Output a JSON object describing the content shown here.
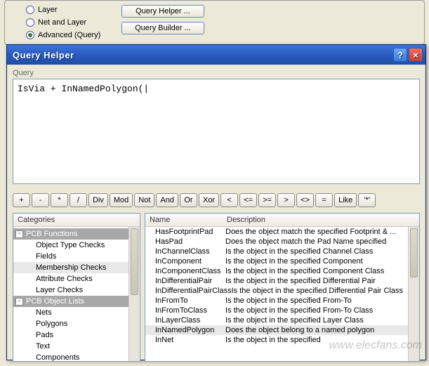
{
  "top_radio": {
    "layer": "Layer",
    "net_and_layer": "Net and Layer",
    "advanced": "Advanced (Query)",
    "selected": "advanced"
  },
  "top_buttons": {
    "query_helper": "Query Helper ...",
    "query_builder": "Query Builder ..."
  },
  "dialog": {
    "title": "Query Helper",
    "help": "?",
    "close": "×",
    "query_label": "Query",
    "query_text": "IsVia + InNamedPolygon(|"
  },
  "ops": [
    "+",
    "-",
    "*",
    "/",
    "Div",
    "Mod",
    "Not",
    "And",
    "Or",
    "Xor",
    "<",
    "<=",
    ">=",
    ">",
    "<>",
    "=",
    "Like",
    "'*'"
  ],
  "categories": {
    "header": "Categories",
    "groups": [
      {
        "name": "PCB Functions",
        "items": [
          "Object Type Checks",
          "Fields",
          "Membership Checks",
          "Attribute Checks",
          "Layer Checks"
        ],
        "selected_index": 2
      },
      {
        "name": "PCB Object Lists",
        "items": [
          "Nets",
          "Polygons",
          "Pads",
          "Text",
          "Components"
        ]
      }
    ]
  },
  "table": {
    "col_name": "Name",
    "col_desc": "Description",
    "rows": [
      {
        "n": "HasFootprintPad",
        "d": "Does the object match the specified Footprint & ..."
      },
      {
        "n": "HasPad",
        "d": "Does the object match the Pad Name specified"
      },
      {
        "n": "InChannelClass",
        "d": "Is the object in the specified Channel Class"
      },
      {
        "n": "InComponent",
        "d": "Is the object in the specified Component"
      },
      {
        "n": "InComponentClass",
        "d": "Is the object in the specified Component Class"
      },
      {
        "n": "InDifferentialPair",
        "d": "Is the object in the specified Differential Pair"
      },
      {
        "n": "InDifferentialPairClass",
        "d": "Is the object in the specified Differential Pair Class"
      },
      {
        "n": "InFromTo",
        "d": "Is the object in the specified From-To"
      },
      {
        "n": "InFromToClass",
        "d": "Is the object in the specified From-To Class"
      },
      {
        "n": "InLayerClass",
        "d": "Is the object in the specified Layer Class"
      },
      {
        "n": "InNamedPolygon",
        "d": "Does the object belong to a named polygon"
      },
      {
        "n": "InNet",
        "d": "Is the object in the specified"
      }
    ],
    "selected_index": 10
  },
  "watermark": "www.elecfans.com"
}
